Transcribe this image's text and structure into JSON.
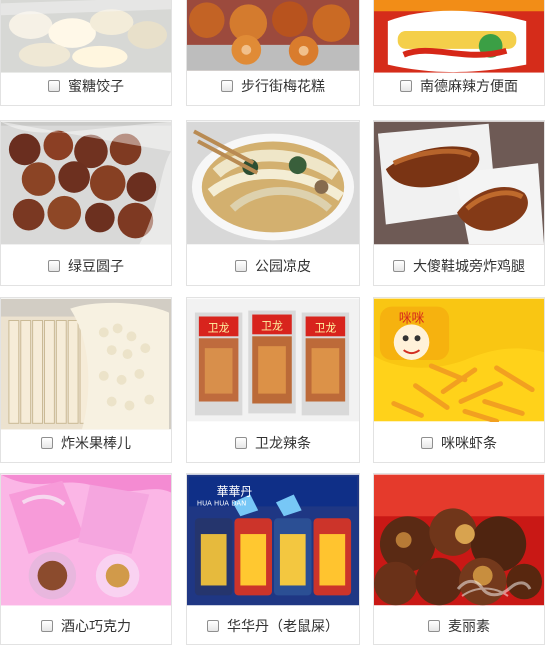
{
  "products": [
    {
      "label": "蜜糖饺子",
      "image_icon": "dumpling-image-icon"
    },
    {
      "label": "步行街梅花糕",
      "image_icon": "plum-blossom-cake-image-icon"
    },
    {
      "label": "南德麻辣方便面",
      "image_icon": "spicy-instant-noodles-image-icon"
    },
    {
      "label": "绿豆圆子",
      "image_icon": "mung-bean-ball-image-icon"
    },
    {
      "label": "公园凉皮",
      "image_icon": "cold-noodles-image-icon"
    },
    {
      "label": "大傻鞋城旁炸鸡腿",
      "image_icon": "fried-chicken-leg-image-icon"
    },
    {
      "label": "炸米果棒儿",
      "image_icon": "fried-rice-stick-image-icon"
    },
    {
      "label": "卫龙辣条",
      "image_icon": "spicy-strip-package-image-icon"
    },
    {
      "label": "咪咪虾条",
      "image_icon": "shrimp-stick-image-icon"
    },
    {
      "label": "酒心巧克力",
      "image_icon": "liqueur-chocolate-image-icon"
    },
    {
      "label": "华华丹（老鼠屎）",
      "image_icon": "candy-package-image-icon"
    },
    {
      "label": "麦丽素",
      "image_icon": "malt-ball-image-icon"
    }
  ],
  "package_texts": {
    "weilong": "卫龙",
    "mimi": "咪咪",
    "huahuadan": "華華丹",
    "huahuadan_pinyin": "HUA HUA DAN"
  },
  "colors": {
    "caption_text": "#333333",
    "card_border": "#e2e2e2",
    "checkbox_border": "#8f8f8f"
  },
  "icons": {
    "checkbox": "checkbox-icon",
    "watermark": "watermark-icon"
  }
}
